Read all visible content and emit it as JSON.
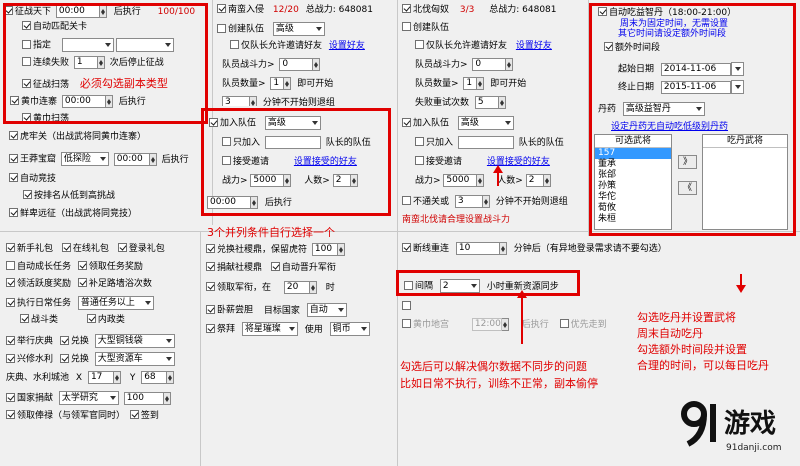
{
  "p1": {
    "expedition": "征战天下",
    "exp_time": "00:00",
    "exp_after": "后执行",
    "exp_count": "100/100",
    "auto_match": "自动匹配关卡",
    "designate": "指定",
    "consec_fail": "连续失败",
    "fail_n": "1",
    "fail_after": "次后停止征战",
    "sweep": "征战扫荡",
    "must_hint": "必须勾选副本类型",
    "yellow": "黄巾连寨",
    "y_time": "00:00",
    "y_after": "后执行",
    "y_sweep": "黄巾扫荡"
  },
  "p2": {
    "south": "南蛮入侵",
    "south_cnt": "12/20",
    "south_power": "总战力: 648081",
    "create_team": "创建队伍",
    "team_level": "高级",
    "allow_invite": "仅队长允许邀请好友",
    "set_friends": "设置好友",
    "member_power": "队员战斗力>",
    "mp_val": "0",
    "member_count": "队员数量>",
    "mc_val": "1",
    "can_start": "即可开始",
    "minutes_val": "3",
    "minutes_text": "分钟不开始则退组",
    "join_team": "加入队伍",
    "jt_level": "高级",
    "only_join": "只加入",
    "leader_team": "队长的队伍",
    "accept": "接受邀请",
    "set_accept": "设置接受的好友",
    "power_gt": "战力>",
    "power_val": "5000",
    "people_gt": "人数>",
    "people_val": "2",
    "run_time": "00:00",
    "run_after": "后执行",
    "three_hint": "3个并列条件自行选择一个"
  },
  "p3": {
    "north": "北伐匈奴",
    "north_cnt": "3/3",
    "north_power": "总战力: 648081",
    "create_team": "创建队伍",
    "allow_invite": "仅队长允许邀请好友",
    "set_friends": "设置好友",
    "member_power": "队员战斗力>",
    "mp_val": "0",
    "member_count": "队员数量>",
    "mc_val": "1",
    "can_start": "即可开始",
    "fail_retry": "失败重试次数",
    "fr_val": "5",
    "join_team": "加入队伍",
    "jt_level": "高级",
    "only_join": "只加入",
    "leader_team": "队长的队伍",
    "accept": "接受邀请",
    "set_accept": "设置接受的好友",
    "power_gt": "战力>",
    "power_val": "5000",
    "people_gt": "人数>",
    "people_val": "2",
    "no_join": "不通关或",
    "no_join_val": "3",
    "no_join_text": "分钟不开始则退组",
    "north_hint": "南蛮北伐请合理设置战斗力"
  },
  "p4": {
    "auto_eat": "自动吃益智丹（18:00-21:00）",
    "hint_line1": "周末为固定时间，无需设置",
    "hint_line2": "其它时间请设定额外时间段",
    "extra_time": "额外时间段",
    "start_label": "起始日期",
    "start_val": "2014-11-06",
    "end_label": "终止日期",
    "end_val": "2015-11-06",
    "pill_label": "丹药",
    "pill_val": "高级益智丹",
    "set_pill": "设定丹药无自动吃低级别丹药",
    "avail_header": "可选武将",
    "eat_header": "吃丹武将",
    "generals": [
      "157",
      "董承",
      "张郃",
      "孙策",
      "华佗",
      "荀攸",
      "朱桓"
    ],
    "add_btn": "》",
    "remove_btn": "《"
  },
  "mid": {
    "tiger": "虎牢关（出战武将同黄巾连寨）",
    "wangmang": "王莽宝窟",
    "wm_level": "低探险",
    "wm_time": "00:00",
    "wm_after": "后执行",
    "auto_compete": "自动竞技",
    "by_rank": "按排名从低到高挑战",
    "xianbei": "鲜卑远征（出战武将同竞技）"
  },
  "bl": {
    "newbie": "新手礼包",
    "online": "在线礼包",
    "login": "登录礼包",
    "auto_growth": "自动成长任务",
    "claim_task": "领取任务奖励",
    "claim_active": "领活跃度奖励",
    "claim_sign": "补足路墙浴次数",
    "daily_task": "执行日常任务",
    "daily_level": "普通任务以上",
    "battle": "战斗类",
    "internal": "内政类",
    "celebration": "举行庆典",
    "exchange": "兑换",
    "exch1": "大型铜钱袋",
    "xingxiu": "兴修水利",
    "exch2": "大型资源车",
    "qingdian_label": "庆典、水利城池",
    "x_label": "X",
    "x_val": "17",
    "y_label": "Y",
    "y_val": "68",
    "donate": "国家捐献",
    "donate_val": "太学研究",
    "donate_n": "100",
    "claim_salary": "领取俸禄（与领军官同时）",
    "sign_in": "签到"
  },
  "bm": {
    "land_salary": "兑换社稷鼎，保留虎符",
    "land_n": "100",
    "donate_ding": "捐献社稷鼎",
    "auto_upgrade": "自动晋升军衔",
    "claim_rank": "领取军衔，在",
    "rank_n": "20",
    "rank_unit": "时",
    "wo": "卧薪尝胆",
    "target": "目标国家",
    "target_val": "自动",
    "sacrifice": "祭拜",
    "sacrifice_val": "将星璀璨",
    "use": "使用",
    "use_val": "铜币"
  },
  "br": {
    "reconnect": "断线重连",
    "reconnect_n": "10",
    "reconnect_text": "分钟后（有异地登录需求请不要勾选）",
    "interval": "间隔",
    "interval_val": "2",
    "interval_text": "小时重新资源同步",
    "cb3_text": "",
    "huangjin": "黄巾地宫",
    "hj_time": "12:00",
    "hj_after": "后执行",
    "priority": "优先走到",
    "sync_hint1": "勾选后可以解决偶尔数据不同步的问题",
    "sync_hint2": "比如日常不执行，训练不正常，副本偷停"
  },
  "right_hint": {
    "l1": "勾选吃丹并设置武将",
    "l2": "周末自动吃丹",
    "l3": "勾选额外时间段并设置",
    "l4": "合理的时间，可以每日吃丹"
  },
  "logo": {
    "brand": "游戏",
    "url": "91danji.com"
  }
}
